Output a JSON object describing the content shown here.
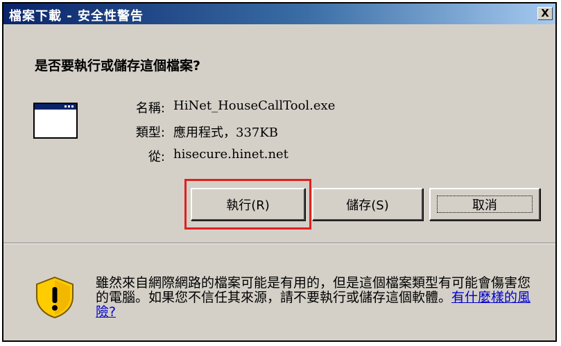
{
  "dialog": {
    "title": "檔案下載 - 安全性警告",
    "close_label": "X",
    "question": "是否要執行或儲存這個檔案?",
    "file": {
      "name_label": "名稱:",
      "name_value": "HiNet_HouseCallTool.exe",
      "type_label": "類型:",
      "type_value": "應用程式，337KB",
      "from_label": "從:",
      "from_value": "hisecure.hinet.net"
    },
    "buttons": {
      "run_label": "執行(R)",
      "save_label": "儲存(S)",
      "cancel_label": "取消"
    },
    "warning": {
      "text": "雖然來自網際網路的檔案可能是有用的，但是這個檔案類型有可能會傷害您的電腦。如果您不信任其來源，請不要執行或儲存這個軟體。",
      "link_label": "有什麼樣的風險?"
    }
  },
  "colors": {
    "titlebar_start": "#0a246a",
    "titlebar_end": "#a6caf0",
    "dialog_bg": "#d4d0c8",
    "highlight": "#e02020",
    "link": "#0000cc"
  }
}
